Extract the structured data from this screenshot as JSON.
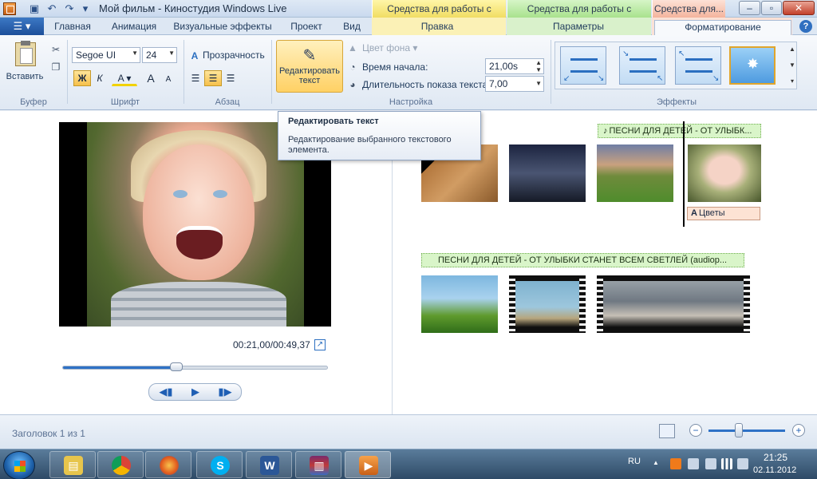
{
  "window": {
    "title": "Мой фильм - Киностудия Windows Live",
    "context_tabs": {
      "video": "Средства для работы с видео",
      "music": "Средства для работы с музыкой",
      "format": "Средства для..."
    }
  },
  "ribbon_tabs": {
    "home": "Главная",
    "animation": "Анимация",
    "visual_effects": "Визуальные эффекты",
    "project": "Проект",
    "view": "Вид",
    "edit": "Правка",
    "options": "Параметры",
    "formatting": "Форматирование"
  },
  "ribbon": {
    "clipboard": {
      "paste": "Вставить",
      "group": "Буфер"
    },
    "font": {
      "family": "Segoe UI",
      "size": "24",
      "bold": "Ж",
      "italic": "К",
      "color": "A",
      "grow": "A",
      "shrink": "A",
      "group": "Шрифт"
    },
    "paragraph": {
      "transparency": "Прозрачность",
      "group": "Абзац"
    },
    "settings": {
      "edit_text_line1": "Редактировать",
      "edit_text_line2": "текст",
      "bg_color": "Цвет фона",
      "start_time_label": "Время начала:",
      "start_time_value": "21,00s",
      "duration_label": "Длительность показа текста:",
      "duration_value": "7,00",
      "group": "Настройка"
    },
    "effects": {
      "group": "Эффекты"
    }
  },
  "tooltip": {
    "title": "Редактировать текст",
    "description": "Редактирование выбранного текстового элемента."
  },
  "preview": {
    "timecode": "00:21,00/00:49,37",
    "progress": 0.43
  },
  "storyboard": {
    "music_top": "ПЕСНИ ДЛЯ ДЕТЕЙ - ОТ УЛЫБК...",
    "caption": "Цветы",
    "music_bottom": "ПЕСНИ ДЛЯ ДЕТЕЙ - ОТ УЛЫБКИ СТАНЕТ ВСЕМ СВЕТЛЕЙ  (audiop..."
  },
  "statusbar": {
    "status": "Заголовок 1 из 1",
    "zoom": 0.4
  },
  "taskbar": {
    "lang": "RU",
    "time": "21:25",
    "date": "02.11.2012"
  },
  "colors": {
    "accent": "#2e72c6",
    "active_button": "#ffd165",
    "context_video": "#f1dd63",
    "context_music": "#a9e28d",
    "context_format": "#f4b49d"
  }
}
